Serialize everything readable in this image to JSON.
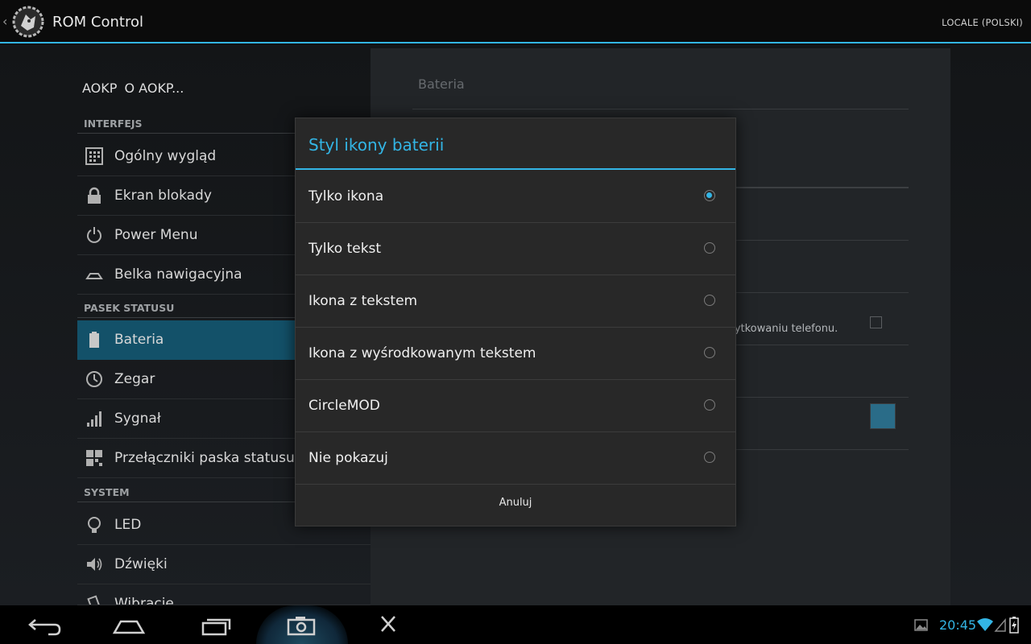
{
  "action_bar": {
    "title": "ROM Control",
    "locale_button": "LOCALE (POLSKI)",
    "accent_color": "#33b5e5"
  },
  "sidebar": {
    "about": {
      "logo_text": "AOKP",
      "label": "O AOKP..."
    },
    "sections": [
      {
        "header": "INTERFEJS",
        "items": [
          {
            "label": "Ogólny wygląd",
            "icon": "grid-icon"
          },
          {
            "label": "Ekran blokady",
            "icon": "lock-icon"
          },
          {
            "label": "Power Menu",
            "icon": "power-icon"
          },
          {
            "label": "Belka nawigacyjna",
            "icon": "navbar-icon"
          }
        ]
      },
      {
        "header": "PASEK STATUSU",
        "items": [
          {
            "label": "Bateria",
            "icon": "battery-icon",
            "selected": true
          },
          {
            "label": "Zegar",
            "icon": "clock-icon"
          },
          {
            "label": "Sygnał",
            "icon": "signal-icon"
          },
          {
            "label": "Przełączniki paska statusu",
            "icon": "toggles-icon"
          }
        ]
      },
      {
        "header": "SYSTEM",
        "items": [
          {
            "label": "LED",
            "icon": "bulb-icon"
          },
          {
            "label": "Dźwięki",
            "icon": "speaker-icon"
          },
          {
            "label": "Wibracje",
            "icon": "vibrate-icon"
          }
        ]
      }
    ]
  },
  "detail_pane": {
    "title": "Bateria",
    "partial_text": "żytkowaniu telefonu.",
    "checkbox_checked": false,
    "swatch_color": "#2a6c88"
  },
  "dialog": {
    "title": "Styl ikony baterii",
    "options": [
      {
        "label": "Tylko ikona",
        "checked": true
      },
      {
        "label": "Tylko tekst",
        "checked": false
      },
      {
        "label": "Ikona z tekstem",
        "checked": false
      },
      {
        "label": "Ikona z wyśrodkowanym tekstem",
        "checked": false
      },
      {
        "label": "CircleMOD",
        "checked": false
      },
      {
        "label": "Nie pokazuj",
        "checked": false
      }
    ],
    "cancel_label": "Anuluj"
  },
  "system_bar": {
    "clock": "20:45"
  }
}
